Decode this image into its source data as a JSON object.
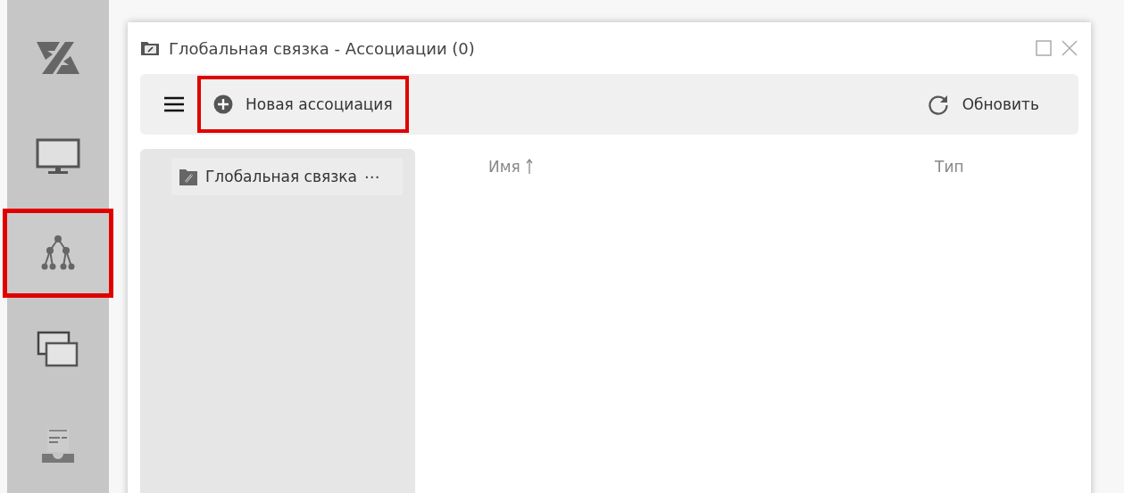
{
  "nav": [
    {
      "kind": "logo",
      "highlighted": false
    },
    {
      "kind": "monitor",
      "highlighted": false
    },
    {
      "kind": "tree",
      "highlighted": true
    },
    {
      "kind": "windows",
      "highlighted": false
    },
    {
      "kind": "inbox",
      "highlighted": false
    }
  ],
  "window": {
    "title": "Глобальная связка - Ассоциации (0)"
  },
  "toolbar": {
    "actions": [
      {
        "label": "Новая ассоциация",
        "highlighted": true
      }
    ],
    "refresh": {
      "label": "Обновить",
      "highlighted": false
    }
  },
  "tree": [
    {
      "label": "Глобальная связка",
      "more": "⋯"
    }
  ],
  "columns": [
    {
      "label": "Имя",
      "sorted": true
    },
    {
      "label": "Тип",
      "sorted": false
    }
  ]
}
